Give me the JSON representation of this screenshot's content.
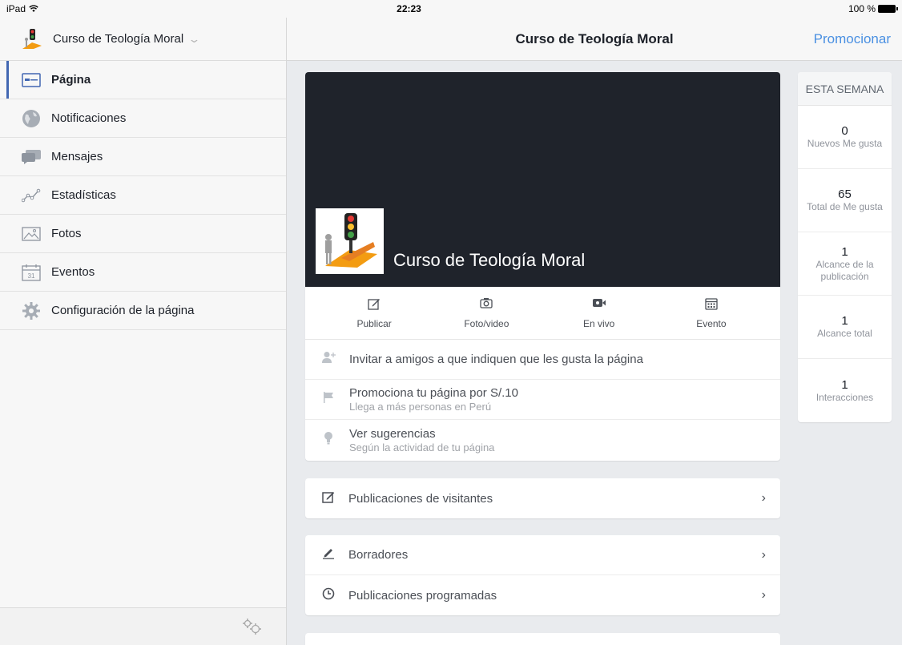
{
  "statusbar": {
    "device": "iPad",
    "time": "22:23",
    "battery": "100 %"
  },
  "sidebar": {
    "page_name": "Curso de Teología Moral",
    "items": [
      {
        "label": "Página",
        "icon": "page-icon",
        "active": true
      },
      {
        "label": "Notificaciones",
        "icon": "globe-icon",
        "active": false
      },
      {
        "label": "Mensajes",
        "icon": "messages-icon",
        "active": false
      },
      {
        "label": "Estadísticas",
        "icon": "stats-icon",
        "active": false
      },
      {
        "label": "Fotos",
        "icon": "photos-icon",
        "active": false
      },
      {
        "label": "Eventos",
        "icon": "calendar-icon",
        "active": false
      },
      {
        "label": "Configuración de la página",
        "icon": "gear-icon",
        "active": false
      }
    ],
    "calendar_day": "31"
  },
  "nav": {
    "title": "Curso de Teología Moral",
    "promote": "Promocionar"
  },
  "cover": {
    "page_name": "Curso de Teología Moral"
  },
  "actions": [
    {
      "label": "Publicar",
      "icon": "edit-icon"
    },
    {
      "label": "Foto/video",
      "icon": "camera-icon"
    },
    {
      "label": "En vivo",
      "icon": "live-video-icon"
    },
    {
      "label": "Evento",
      "icon": "calendar-icon"
    }
  ],
  "suggestions": [
    {
      "title": "Invitar a amigos a que indiquen que les gusta la página",
      "subtitle": "",
      "icon": "add-friend-icon"
    },
    {
      "title": "Promociona tu página por S/.10",
      "subtitle": "Llega a más personas en Perú",
      "icon": "flag-icon"
    },
    {
      "title": "Ver sugerencias",
      "subtitle": "Según la actividad de tu página",
      "icon": "lightbulb-icon"
    }
  ],
  "lists": {
    "visitors": "Publicaciones de visitantes",
    "drafts": "Borradores",
    "scheduled": "Publicaciones programadas"
  },
  "stats": {
    "heading": "ESTA SEMANA",
    "items": [
      {
        "value": "0",
        "label": "Nuevos Me gusta"
      },
      {
        "value": "65",
        "label": "Total de Me gusta"
      },
      {
        "value": "1",
        "label": "Alcance de la publicación"
      },
      {
        "value": "1",
        "label": "Alcance total"
      },
      {
        "value": "1",
        "label": "Interacciones"
      }
    ]
  },
  "colors": {
    "accent": "#4267b2",
    "link": "#4a90e2",
    "cover_bg": "#1f232b"
  }
}
